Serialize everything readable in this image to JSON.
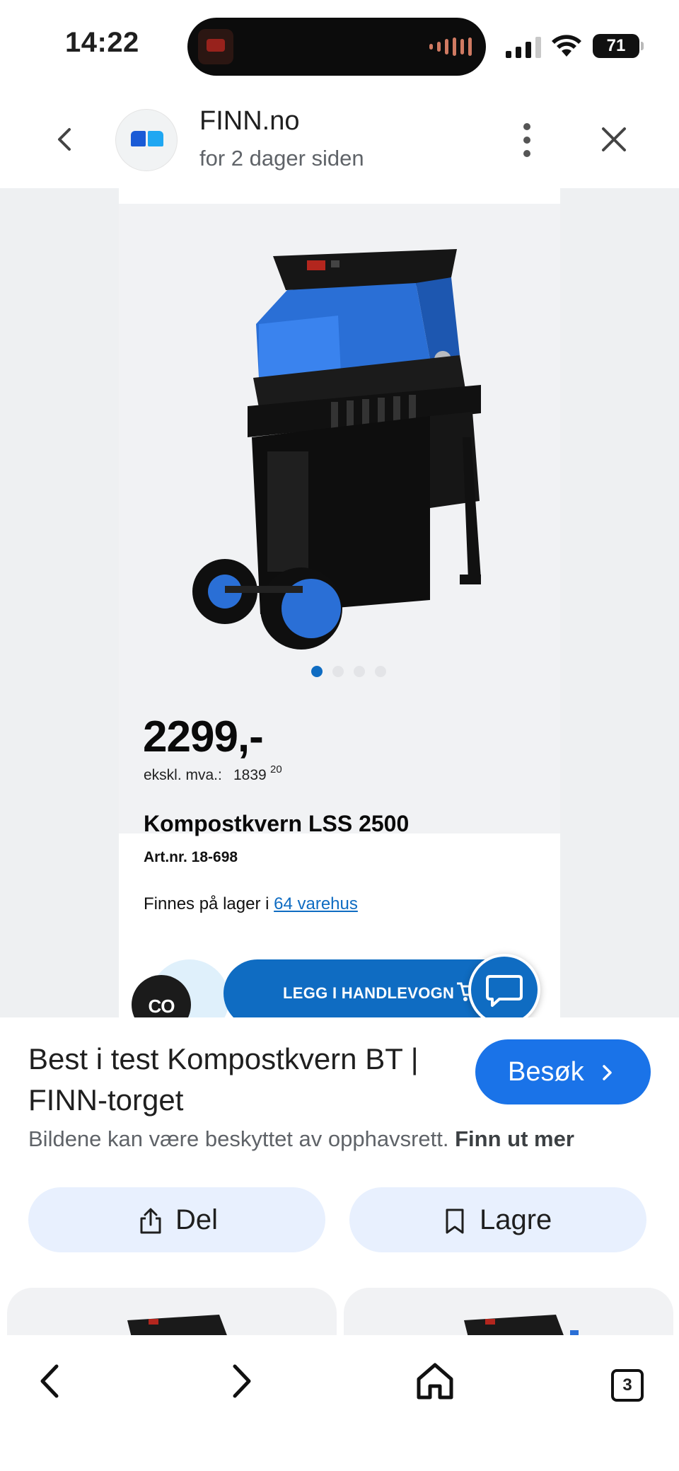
{
  "status_bar": {
    "time": "14:22",
    "battery": "71"
  },
  "header": {
    "site_name": "FINN.no",
    "age": "for 2 dager siden"
  },
  "product": {
    "price": "2299,-",
    "excl_vat_label": "ekskl. mva.:",
    "excl_vat_value": "1839",
    "excl_vat_decimals": "20",
    "name": "Kompostkvern LSS 2500",
    "art_nr": "Art.nr. 18-698",
    "stock_prefix": "Finnes på lager i",
    "stock_link": "64 varehus",
    "cart_button": "LEGG I HANDLEVOGN",
    "co_badge": "CO"
  },
  "info": {
    "title": "Best i test Kompostkvern BT | FINN-torget",
    "visit_button": "Besøk",
    "copyright": "Bildene kan være beskyttet av opphavsrett.",
    "learn_more": "Finn ut mer",
    "share_button": "Del",
    "save_button": "Lagre"
  },
  "bottom_nav": {
    "tab_count": "3"
  },
  "colors": {
    "finn_blue": "#0f6cc2",
    "google_blue": "#1a73e8",
    "chip_bg": "#e8f0fe"
  },
  "carousel": {
    "total": 4,
    "active": 1
  }
}
